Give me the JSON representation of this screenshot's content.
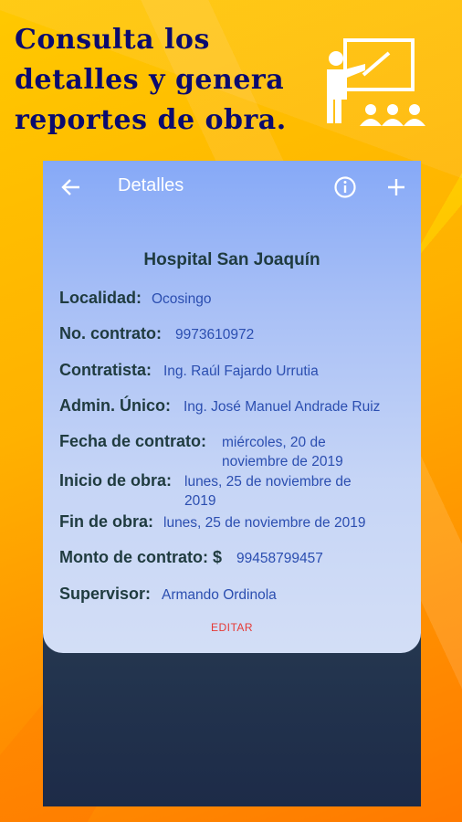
{
  "promo": {
    "headline_lines": [
      "Consulta los",
      "detalles y genera",
      "reportes de obra."
    ]
  },
  "colors": {
    "headline": "#0b0b6e",
    "label": "#1f3b3f",
    "value": "#2b4eb0",
    "edit": "#e53935",
    "appbar_text": "#ffffff"
  },
  "appbar": {
    "title": "Detalles",
    "icons": [
      "back-arrow-icon",
      "info-icon",
      "add-icon"
    ]
  },
  "details": {
    "project_name": "Hospital San Joaquín",
    "fields": [
      {
        "label": "Localidad:",
        "value": "Ocosingo"
      },
      {
        "label": "No. contrato:",
        "value": "9973610972"
      },
      {
        "label": "Contratista:",
        "value": "Ing. Raúl Fajardo Urrutia"
      },
      {
        "label": "Admin. Único:",
        "value": "Ing. José Manuel Andrade Ruiz"
      },
      {
        "label": "Fecha de contrato:",
        "value_lines": [
          "miércoles, 20 de",
          "noviembre de 2019"
        ]
      },
      {
        "label": "Inicio de obra:",
        "value_lines": [
          "lunes, 25 de noviembre de",
          "2019"
        ]
      },
      {
        "label": "Fin de obra:",
        "value": "lunes, 25 de noviembre de 2019"
      },
      {
        "label": "Monto de contrato: $",
        "value": "99458799457"
      },
      {
        "label": "Supervisor:",
        "value": "Armando Ordinola"
      }
    ],
    "edit_label": "EDITAR"
  }
}
